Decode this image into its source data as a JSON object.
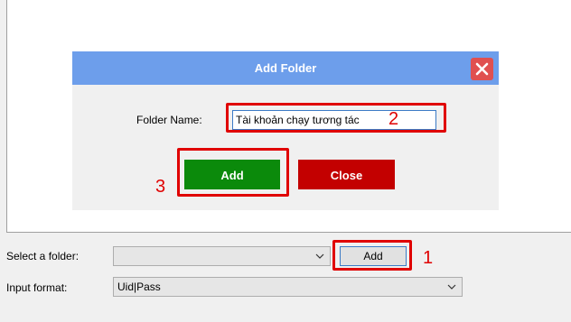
{
  "dialog": {
    "title": "Add Folder",
    "folder_name_label": "Folder Name:",
    "folder_name_value": "Tài khoản chạy tương tác",
    "add_label": "Add",
    "close_label": "Close"
  },
  "form": {
    "select_folder_label": "Select a folder:",
    "select_folder_value": "",
    "add_label": "Add",
    "input_format_label": "Input format:",
    "input_format_value": "Uid|Pass"
  },
  "callouts": {
    "step1": "1",
    "step2": "2",
    "step3": "3"
  },
  "colors": {
    "titlebar": "#6d9eeb",
    "add_button": "#0b8a0b",
    "close_button": "#c30000",
    "highlight": "#e00000"
  },
  "icons": {
    "dialog_close": "close-icon",
    "dropdown": "chevron-down-icon"
  }
}
